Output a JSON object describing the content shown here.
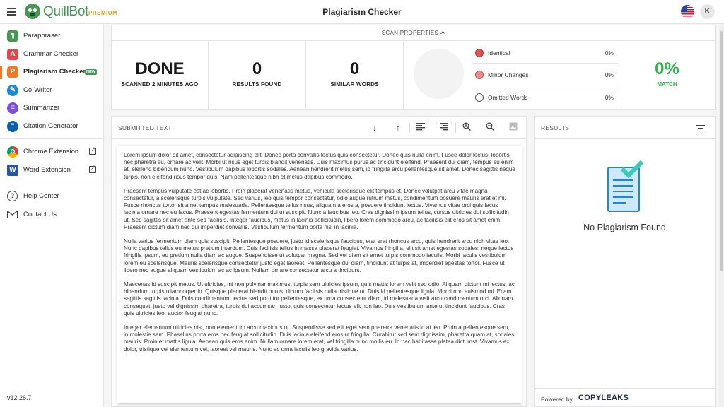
{
  "app": {
    "logo_text": "QuillBot",
    "premium_label": "PREMIUM",
    "page_title": "Plagiarism Checker",
    "avatar_initial": "K"
  },
  "sidebar": {
    "items": [
      {
        "label": "Paraphraser",
        "icon": "paraphraser-icon",
        "color": "#499557"
      },
      {
        "label": "Grammar Checker",
        "icon": "grammar-checker-icon",
        "color": "#e0474c"
      },
      {
        "label": "Plagiarism Checker",
        "icon": "plagiarism-checker-icon",
        "color": "#ee7b2c",
        "badge": "NEW",
        "active": true
      },
      {
        "label": "Co-Writer",
        "icon": "co-writer-icon",
        "color": "#1a8ad6"
      },
      {
        "label": "Summarizer",
        "icon": "summarizer-icon",
        "color": "#7b4fd6"
      },
      {
        "label": "Citation Generator",
        "icon": "citation-generator-icon",
        "color": "#0f5fa6"
      }
    ],
    "extensions": [
      {
        "label": "Chrome Extension",
        "icon": "chrome-icon"
      },
      {
        "label": "Word Extension",
        "icon": "word-icon"
      }
    ],
    "support": [
      {
        "label": "Help Center",
        "icon": "help-icon"
      },
      {
        "label": "Contact Us",
        "icon": "mail-icon"
      }
    ],
    "version": "v12.26.7"
  },
  "scan": {
    "header": "SCAN PROPERTIES",
    "status_value": "DONE",
    "status_label": "SCANNED 2 MINUTES AGO",
    "results_value": "0",
    "results_label": "RESULTS FOUND",
    "similar_value": "0",
    "similar_label": "SIMILAR WORDS",
    "legend": [
      {
        "name": "Identical",
        "pct": "0%",
        "color": "#e55353"
      },
      {
        "name": "Minor Changes",
        "pct": "0%",
        "color": "#ef8c8c"
      },
      {
        "name": "Omitted Words",
        "pct": "0%",
        "color": "#ffffff"
      }
    ],
    "match_value": "0%",
    "match_label": "MATCH",
    "match_color": "#36b150"
  },
  "submitted": {
    "title": "SUBMITTED TEXT",
    "paragraphs": [
      "Lorem ipsum dolor sit amet, consectetur adipiscing elit. Donec porta convallis lectus quis consectetur. Donec quis nulla enim. Fusce dolor lectus, lobortis nec pharetra eu, ornare ac velit. Morbi ut risus eget turpis blandit venenatis. Duis maximus purus ac tincidunt eleifend. Praesent dui diam, tempus eu enim at, eleifend bibendum nunc. Vestibulum dapibus lobortis sodales. Aenean hendrerit metus sem, id fringilla arcu pellentesque sit amet. Donec sagittis neque turpis, non eleifend risus tempor quis. Nam pellentesque nibh et metus dapibus commodo.",
      "Praesent tempus vulputate est ac lobortis. Proin placerat venenatis metus, vehicula scelerisque elit tempus et. Donec volutpat arcu vitae magna consectetur, a scelerisque turpis vulputate. Sed varius, leo quis tempor consectetur, odio augue rutrum metus, condimentum posuere mauris erat et mi. Fusce rhoncus tortor sit amet tempus malesuada. Pellentesque tellus risus, aliquam a eros a, posuere tincidunt lectus. Vivamus vitae orci quis lacus lacinia ornare nec eu lacus. Praesent egestas fermentum dui ut suscipit. Nunc a faucibus leo. Cras dignissim ipsum tellus, cursus ultricies dui sollicitudin ut. Sed sagittis sit amet ante sed facilisis. Integer faucibus, metus in lacinia sollicitudin, libero lorem commodo arcu, ac facilisis elit eros sit amet enim. Praesent dictum diam nec dui imperdiet convallis. Vestibulum fermentum porta nisl in lacinia.",
      "Nulla varius fermentum diam quis suscipit. Pellentesque posuere, justo id scelerisque faucibus, erat erat rhoncus arcu, quis hendrerit arcu nibh vitae leo. Nunc dapibus tellus eu metus pretium interdum. Duis facilisis tellus in massa placerat feugiat. Vivamus fringilla, elit sit amet egestas sodales, neque lectus fringilla ipsum, eu pretium nulla diam ac augue. Suspendisse ut volutpat magna. Sed vel diam sit amet turpis commodo iaculis. Morbi iaculis vestibulum lorem eu scelerisque. Mauris scelerisque consectetur justo eget laoreet. Pellentesque dui diam, tincidunt at turpis at, imperdiet egestas tortor. Fusce ut libero nec augue aliquam vestibulum ac ac ipsum. Nullam ornare consectetur arcu a tincidunt.",
      "Maecenas id suscipit metus. Ut ultricies, mi non pulvinar maximus, turpis sem ultricies ipsum, quis mattis lorem velit sed odio. Aliquam dictum mi lectus, ac bibendum turpis ullamcorper in. Quisque placerat blandit purus, dictum facilisis nulla tristique ut. Duis id pellentesque ligula. Morbi non euismod mi. Etiam sagittis sagittis lacinia. Duis condimentum, lectus sed porttitor pellentesque, ex urna consectetur diam, id malesuada velit arcu condimentum orci. Aliquam consequat, justo vel dignissim pharetra, turpis dui accumsan justo, quis consectetur lectus elit non leo. Duis vestibulum ante ut tincidunt faucibus. Cras quis ultricies leo, auctor feugiat nunc.",
      "Integer elementum ultricies nisi, non elementum arcu maximus ut. Suspendisse sed elit eget sem pharetra venenatis id at leo. Proin a pellentesque sem, in molestie sem. Phasellus porta eros nec feugiat sollicitudin. Duis lacinia eleifend eros ut fringilla. Curabitur sed sem dignissim, pharetra quam at, sodales mauris. Proin et mattis ligula. Aenean quis eros enim. Nullam ornare lorem erat, vel fringilla nunc mollis eu. In hac habitasse platea dictumst. Vivamus ex dolor, tristique vel elementum vel, laoreet vel mauris. Nunc ac urna iaculis leo gravida varius."
    ]
  },
  "results": {
    "title": "RESULTS",
    "empty_message": "No Plagiarism Found",
    "powered_by": "Powered by",
    "brand": "COPYLEAKS"
  }
}
